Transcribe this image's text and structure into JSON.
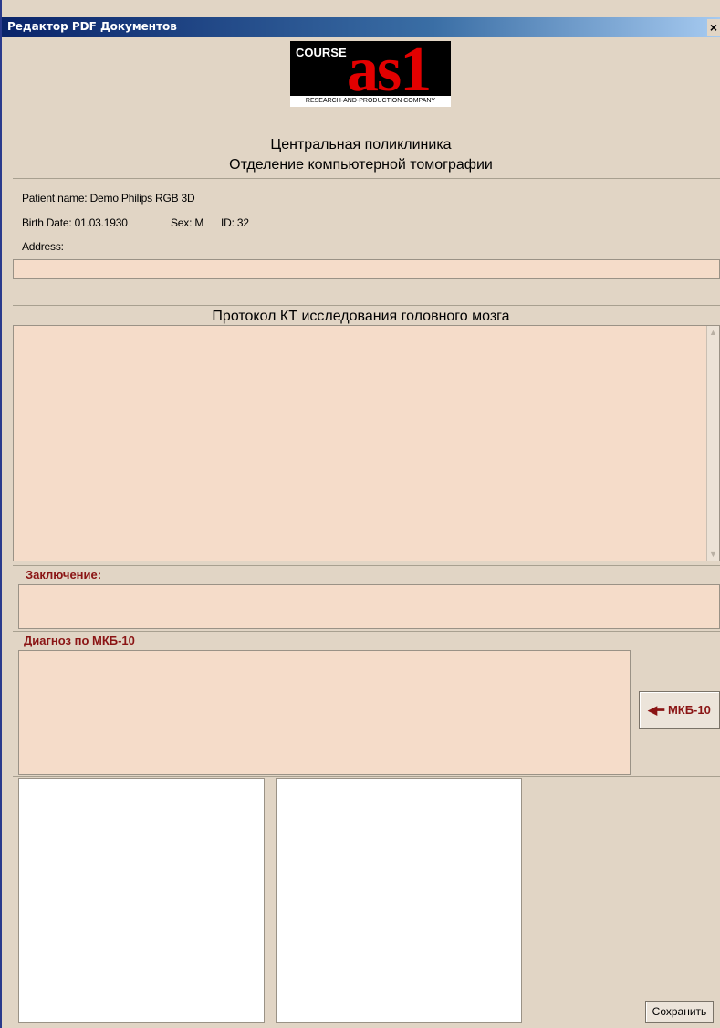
{
  "window": {
    "title": "Редактор PDF Документов",
    "close_glyph": "×"
  },
  "logo": {
    "course": "COURSE",
    "brand": "as1",
    "tagline": "RESEARCH-AND-PRODUCTION COMPANY"
  },
  "header": {
    "clinic_name": "Центральная поликлиника",
    "department": "Отделение компьютерной томографии"
  },
  "patient": {
    "name_line": "Patient name: Demo Philips RGB 3D",
    "birth_date": "Birth Date: 01.03.1930",
    "sex": "Sex: M",
    "id": "ID: 32",
    "address_label": "Address:",
    "address_value": ""
  },
  "protocol": {
    "title": "Протокол КТ исследования головного мозга",
    "text": ""
  },
  "conclusion": {
    "label": "Заключение:",
    "text": ""
  },
  "diagnosis": {
    "label": "Диагноз по МКБ-10",
    "text": "",
    "mkb_button_label": "МКБ-10",
    "mkb_button_icon": "arrow-left-icon"
  },
  "footer": {
    "save_label": "Сохранить"
  },
  "colors": {
    "window_bg": "#e1d5c5",
    "field_bg": "#f5dcc9",
    "label_red": "#8a1414",
    "title_bar": "#0a246a"
  }
}
